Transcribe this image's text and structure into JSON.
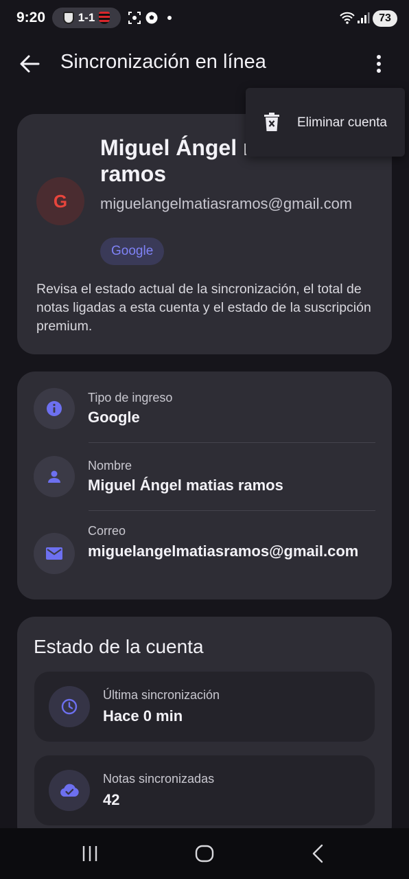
{
  "status_bar": {
    "time": "9:20",
    "match_score": "1-1",
    "battery": "73"
  },
  "app_bar": {
    "title": "Sincronización en línea",
    "back_icon": "arrow-back-icon",
    "more_icon": "more-vert-icon"
  },
  "popup_menu": {
    "items": [
      {
        "label": "Eliminar cuenta",
        "icon": "delete-icon"
      }
    ]
  },
  "profile": {
    "avatar_letter": "G",
    "name": "Miguel Ángel matias ramos",
    "email": "miguelangelmatiasramos@gmail.com",
    "provider_chip": "Google",
    "description": "Revisa el estado actual de la sincronización, el total de notas ligadas a esta cuenta y el estado de la suscripción premium."
  },
  "account_info": {
    "rows": [
      {
        "label": "Tipo de ingreso",
        "value": "Google",
        "icon": "info-icon"
      },
      {
        "label": "Nombre",
        "value": "Miguel Ángel matias ramos",
        "icon": "person-icon"
      },
      {
        "label": "Correo",
        "value": "miguelangelmatiasramos@gmail.com",
        "icon": "mail-icon"
      }
    ]
  },
  "account_status": {
    "title": "Estado de la cuenta",
    "items": [
      {
        "label": "Última sincronización",
        "value": "Hace 0 min",
        "icon": "clock-icon"
      },
      {
        "label": "Notas sincronizadas",
        "value": "42",
        "icon": "cloud-done-icon"
      }
    ]
  },
  "colors": {
    "background": "#16151b",
    "card": "#2e2d35",
    "accent": "#6d70f0",
    "avatar_letter": "#e8453c"
  }
}
